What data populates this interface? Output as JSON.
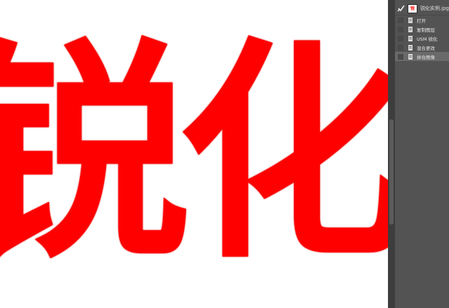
{
  "canvas": {
    "text": "锐化",
    "text_color": "#ff0000"
  },
  "history_panel": {
    "snapshot": {
      "thumb_text": "锐化",
      "label": "锐化实例.jpg"
    },
    "items": [
      {
        "label": "打开",
        "active": false
      },
      {
        "label": "复制图层",
        "active": false
      },
      {
        "label": "USM 锐化",
        "active": false
      },
      {
        "label": "混合更改",
        "active": false
      },
      {
        "label": "拼合图像",
        "active": true
      }
    ]
  },
  "colors": {
    "panel_bg": "#535353",
    "scrollbar_bg": "#3d3d3d",
    "active_row": "#6a6a6a"
  }
}
